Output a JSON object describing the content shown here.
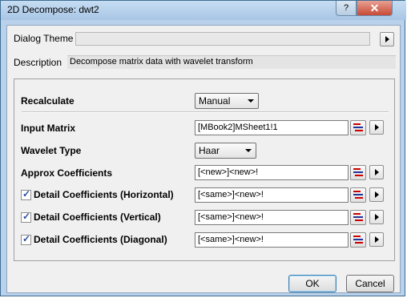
{
  "window": {
    "title": "2D Decompose: dwt2",
    "help_label": "?",
    "close_label": "✕"
  },
  "header": {
    "dialog_theme_label": "Dialog Theme",
    "dialog_theme_value": "",
    "description_label": "Description",
    "description_value": "Decompose matrix data with wavelet transform"
  },
  "params": {
    "recalculate": {
      "label": "Recalculate",
      "value": "Manual"
    },
    "input_matrix": {
      "label": "Input Matrix",
      "value": "[MBook2]MSheet1!1"
    },
    "wavelet_type": {
      "label": "Wavelet Type",
      "value": "Haar"
    },
    "approx": {
      "label": "Approx Coefficients",
      "value": "[<new>]<new>!"
    },
    "detail_h": {
      "label": "Detail Coefficients (Horizontal)",
      "value": "[<same>]<new>!",
      "checked": true
    },
    "detail_v": {
      "label": "Detail Coefficients (Vertical)",
      "value": "[<same>]<new>!",
      "checked": true
    },
    "detail_d": {
      "label": "Detail Coefficients (Diagonal)",
      "value": "[<same>]<new>!",
      "checked": true
    }
  },
  "buttons": {
    "ok": "OK",
    "cancel": "Cancel"
  }
}
